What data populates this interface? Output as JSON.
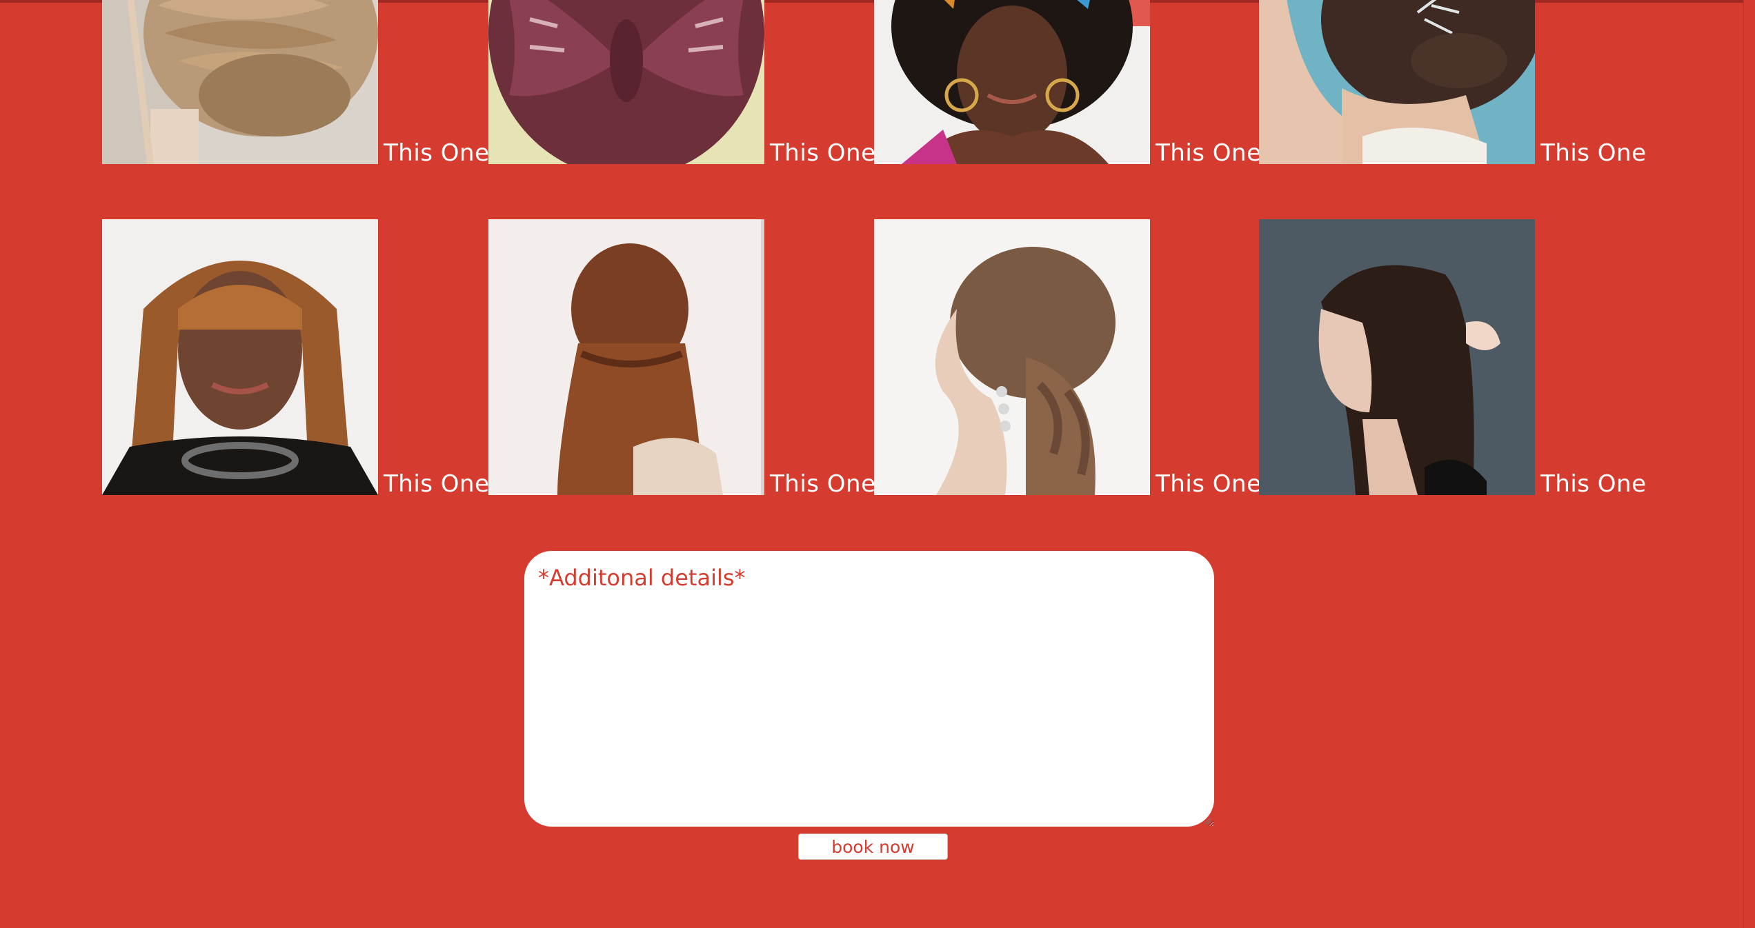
{
  "gallery": {
    "rows": [
      [
        {
          "label": "This One",
          "photo": "braided-updo-back-view"
        },
        {
          "label": "This One",
          "photo": "butterfly-braid-back-view"
        },
        {
          "label": "This One",
          "photo": "afro-with-butterflies-hoop-earrings"
        },
        {
          "label": "This One",
          "photo": "low-curly-updo-with-hair-pin"
        }
      ],
      [
        {
          "label": "This One",
          "photo": "shoulder-length-bangs-portrait"
        },
        {
          "label": "This One",
          "photo": "half-up-twist-long-hair-back-view"
        },
        {
          "label": "This One",
          "photo": "half-up-curls-side-profile"
        },
        {
          "label": "This One",
          "photo": "long-straight-hair-side-profile"
        }
      ]
    ]
  },
  "form": {
    "details_placeholder": "*Additonal details*",
    "submit_label": "book now"
  },
  "colors": {
    "background": "#d63b2f",
    "text_on_background": "#ffffff",
    "accent_text": "#d63b2f"
  }
}
